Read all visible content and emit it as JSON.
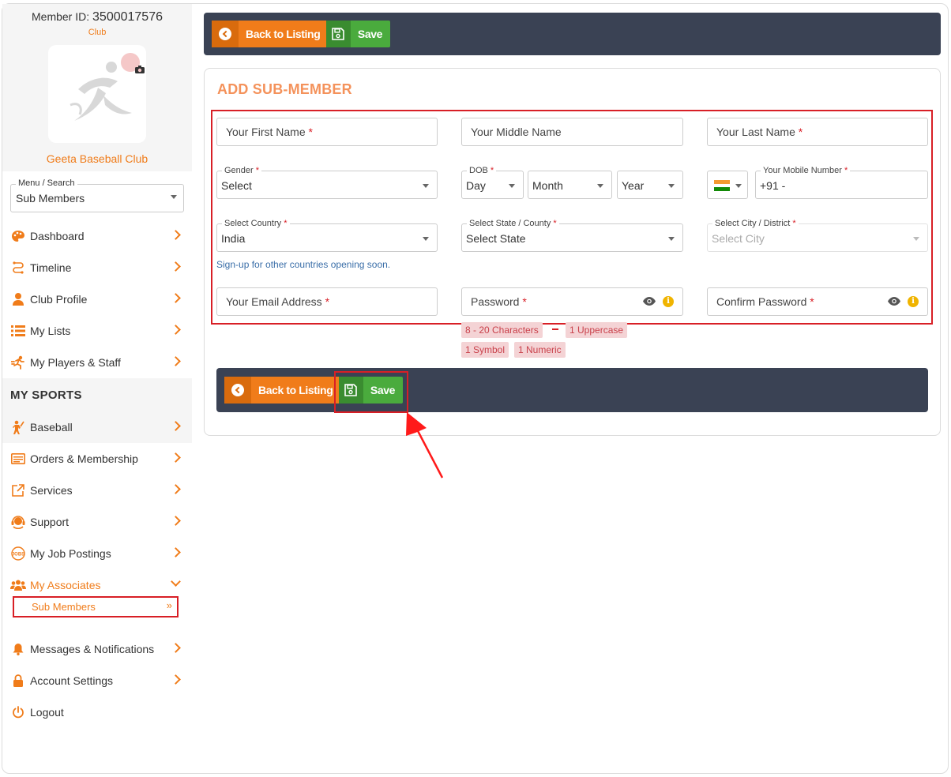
{
  "sidebar": {
    "member_id_label": "Member ID:",
    "member_id": "3500017576",
    "member_type": "Club",
    "club_name": "Geeta Baseball Club",
    "menu_search": {
      "legend": "Menu / Search",
      "value": "Sub Members"
    },
    "items": [
      {
        "label": "Dashboard",
        "icon": "palette-icon"
      },
      {
        "label": "Timeline",
        "icon": "route-icon"
      },
      {
        "label": "Club Profile",
        "icon": "user-icon"
      },
      {
        "label": "My Lists",
        "icon": "list-icon"
      },
      {
        "label": "My Players & Staff",
        "icon": "runner-icon"
      }
    ],
    "section_title": "MY SPORTS",
    "sports": [
      {
        "label": "Baseball",
        "icon": "baseball-player-icon"
      }
    ],
    "items2": [
      {
        "label": "Orders & Membership",
        "icon": "orders-icon"
      },
      {
        "label": "Services",
        "icon": "share-icon"
      },
      {
        "label": "Support",
        "icon": "headset-icon"
      },
      {
        "label": "My Job Postings",
        "icon": "jobs-icon"
      },
      {
        "label": "My Associates",
        "icon": "users-icon"
      }
    ],
    "sub_item": "Sub Members",
    "items3": [
      {
        "label": "Messages & Notifications",
        "icon": "bell-icon"
      },
      {
        "label": "Account Settings",
        "icon": "lock-icon"
      },
      {
        "label": "Logout",
        "icon": "power-icon"
      }
    ]
  },
  "toolbar": {
    "back_label": "Back to Listing",
    "save_label": "Save"
  },
  "form": {
    "title": "ADD SUB-MEMBER",
    "first_name": "Your First Name",
    "middle_name": "Your Middle Name",
    "last_name": "Your Last Name",
    "required_mark": "*",
    "gender": {
      "legend": "Gender",
      "value": "Select"
    },
    "dob": {
      "legend": "DOB",
      "day": "Day",
      "month": "Month",
      "year": "Year"
    },
    "mobile": {
      "legend": "Your Mobile Number",
      "value": "+91 -"
    },
    "country": {
      "legend": "Select Country",
      "value": "India"
    },
    "state": {
      "legend": "Select State / County",
      "value": "Select State"
    },
    "city": {
      "legend": "Select City / District",
      "value": "Select City"
    },
    "hint": "Sign-up for other countries opening soon.",
    "email": "Your Email Address",
    "password": "Password",
    "confirm_password": "Confirm Password",
    "rules": [
      "8 - 20 Characters",
      "1 Uppercase",
      "1 Symbol",
      "1 Numeric"
    ]
  },
  "colors": {
    "accent": "#f07c1a",
    "dark_bar": "#3a4254",
    "save_green": "#4aab3d",
    "highlight_red": "#d81f26"
  }
}
